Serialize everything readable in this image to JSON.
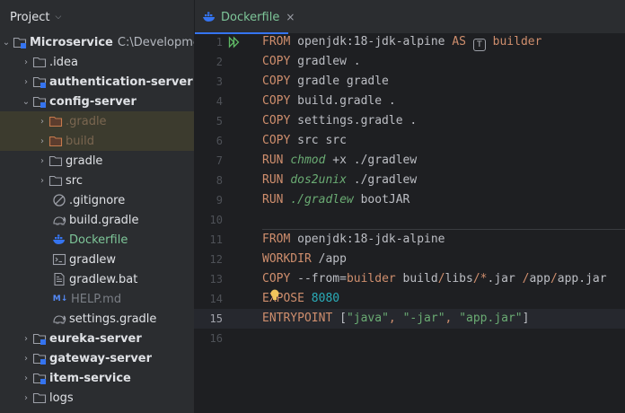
{
  "project_panel": {
    "title": "Project",
    "tree": [
      {
        "label": "Microservice",
        "path": "C:\\Developme",
        "type": "module-root",
        "expanded": true
      },
      {
        "label": ".idea",
        "type": "folder",
        "expanded": false
      },
      {
        "label": "authentication-server",
        "type": "module",
        "expanded": false
      },
      {
        "label": "config-server",
        "type": "module",
        "expanded": true
      },
      {
        "label": ".gradle",
        "type": "folder-excluded",
        "expanded": false
      },
      {
        "label": "build",
        "type": "folder-excluded",
        "expanded": false
      },
      {
        "label": "gradle",
        "type": "folder",
        "expanded": false
      },
      {
        "label": "src",
        "type": "folder",
        "expanded": false
      },
      {
        "label": ".gitignore",
        "type": "file-ignore"
      },
      {
        "label": "build.gradle",
        "type": "file-gradle"
      },
      {
        "label": "Dockerfile",
        "type": "file-docker"
      },
      {
        "label": "gradlew",
        "type": "file-shell"
      },
      {
        "label": "gradlew.bat",
        "type": "file-bat"
      },
      {
        "label": "HELP.md",
        "type": "file-md"
      },
      {
        "label": "settings.gradle",
        "type": "file-gradle"
      },
      {
        "label": "eureka-server",
        "type": "module",
        "expanded": false
      },
      {
        "label": "gateway-server",
        "type": "module",
        "expanded": false
      },
      {
        "label": "item-service",
        "type": "module",
        "expanded": false
      },
      {
        "label": "logs",
        "type": "folder",
        "expanded": false
      }
    ]
  },
  "editor": {
    "tab": {
      "label": "Dockerfile",
      "close": "×"
    },
    "line_numbers": [
      "1",
      "2",
      "3",
      "4",
      "5",
      "6",
      "7",
      "8",
      "9",
      "10",
      "11",
      "12",
      "13",
      "14",
      "15",
      "16"
    ],
    "current_line": "15",
    "lines": {
      "l1": {
        "kw": "FROM",
        "a": " openjdk:18-jdk-alpine ",
        "as": "AS",
        "tag": "T",
        "name": "builder"
      },
      "l2": {
        "kw": "COPY",
        "a": " gradlew ."
      },
      "l3": {
        "kw": "COPY",
        "a": " gradle gradle"
      },
      "l4": {
        "kw": "COPY",
        "a": " build.gradle ."
      },
      "l5": {
        "kw": "COPY",
        "a": " settings.gradle ."
      },
      "l6": {
        "kw": "COPY",
        "a": " src src"
      },
      "l7": {
        "kw": "RUN",
        "cmd": "chmod",
        "a": " +x ./gradlew"
      },
      "l8": {
        "kw": "RUN",
        "cmd": "dos2unix",
        "a": " ./gradlew"
      },
      "l9": {
        "kw": "RUN",
        "cmd": "./gradlew",
        "a": " bootJAR"
      },
      "l11": {
        "kw": "FROM",
        "a": " openjdk:18-jdk-alpine"
      },
      "l12": {
        "kw": "WORKDIR",
        "a": " /app"
      },
      "l13": {
        "kw": "COPY",
        "flag": " --from=",
        "from": "builder",
        "a": " build",
        "s1": "/",
        "b": "libs",
        "s2": "/",
        "glob": "*",
        "c": ".jar ",
        "s3": "/",
        "d": "app",
        "s4": "/",
        "e": "app.jar"
      },
      "l14": {
        "kw": "EXPOSE",
        "num": "8080"
      },
      "l15": {
        "kw": "ENTRYPOINT",
        "open": " [",
        "s1": "\"java\"",
        "c1": ", ",
        "s2": "\"-jar\"",
        "c2": ", ",
        "s3": "\"app.jar\"",
        "close": "]"
      }
    }
  },
  "colors": {
    "panel_bg": "#2b2d30",
    "editor_bg": "#1e1f22",
    "keyword": "#cf8e6d",
    "string": "#6aab73",
    "number": "#2aacb8",
    "accent": "#3574f0"
  }
}
